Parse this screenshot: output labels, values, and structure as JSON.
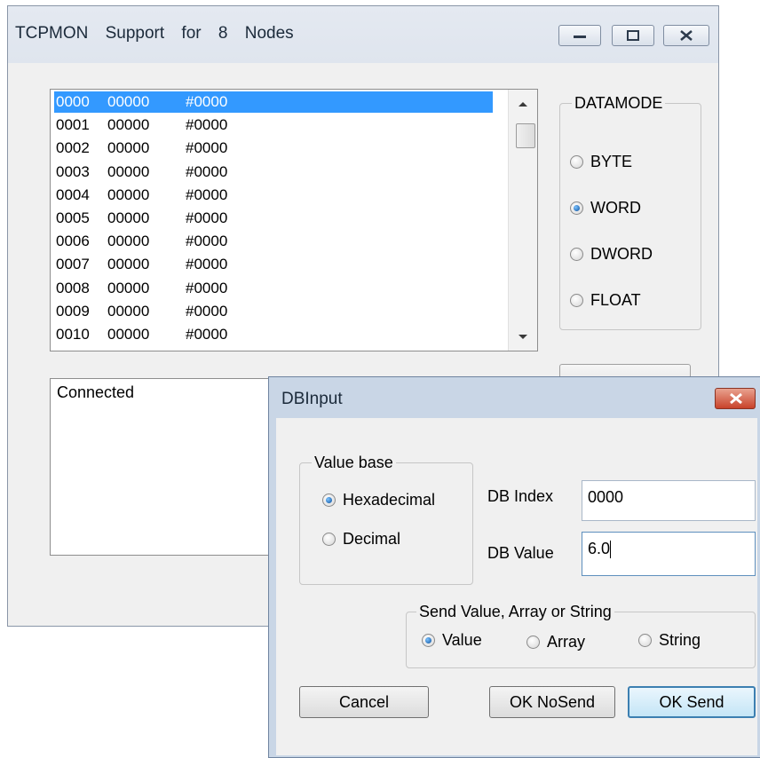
{
  "main_window": {
    "title": "TCPMON    Support for 8 Nodes"
  },
  "list": {
    "rows": [
      {
        "index": "0000",
        "dec": "00000",
        "hex": "#0000"
      },
      {
        "index": "0001",
        "dec": "00000",
        "hex": "#0000"
      },
      {
        "index": "0002",
        "dec": "00000",
        "hex": "#0000"
      },
      {
        "index": "0003",
        "dec": "00000",
        "hex": "#0000"
      },
      {
        "index": "0004",
        "dec": "00000",
        "hex": "#0000"
      },
      {
        "index": "0005",
        "dec": "00000",
        "hex": "#0000"
      },
      {
        "index": "0006",
        "dec": "00000",
        "hex": "#0000"
      },
      {
        "index": "0007",
        "dec": "00000",
        "hex": "#0000"
      },
      {
        "index": "0008",
        "dec": "00000",
        "hex": "#0000"
      },
      {
        "index": "0009",
        "dec": "00000",
        "hex": "#0000"
      },
      {
        "index": "0010",
        "dec": "00000",
        "hex": "#0000"
      }
    ],
    "selected_index": 0
  },
  "datamode": {
    "title": "DATAMODE",
    "options": [
      {
        "label": "BYTE",
        "checked": false
      },
      {
        "label": "WORD",
        "checked": true
      },
      {
        "label": "DWORD",
        "checked": false
      },
      {
        "label": "FLOAT",
        "checked": false
      }
    ]
  },
  "status": {
    "text": "Connected"
  },
  "dialog": {
    "title": "DBInput",
    "value_base": {
      "title": "Value base",
      "options": [
        {
          "label": "Hexadecimal",
          "checked": true
        },
        {
          "label": "Decimal",
          "checked": false
        }
      ]
    },
    "db_index": {
      "label": "DB Index",
      "value": "0000"
    },
    "db_value": {
      "label": "DB Value",
      "value": "6.0"
    },
    "send_mode": {
      "title": "Send  Value,  Array or String",
      "options": [
        {
          "label": "Value",
          "checked": true
        },
        {
          "label": "Array",
          "checked": false
        },
        {
          "label": "String",
          "checked": false
        }
      ]
    },
    "buttons": {
      "cancel": "Cancel",
      "ok_nosend": "OK NoSend",
      "ok_send": "OK Send"
    }
  },
  "colors": {
    "selection": "#3399ff",
    "close_button": "#c8422a"
  }
}
